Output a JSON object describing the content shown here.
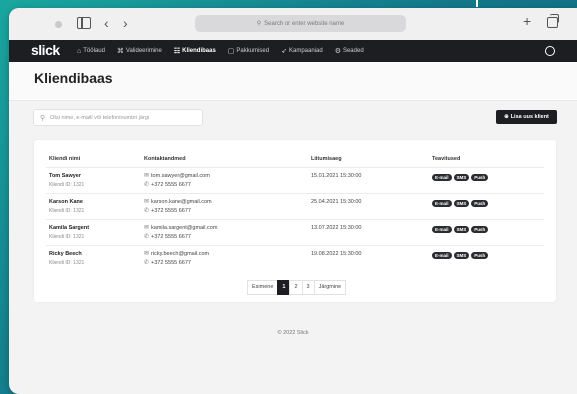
{
  "browser": {
    "address_placeholder": "Search or enter website name"
  },
  "app": {
    "logo": "slick",
    "nav": [
      {
        "icon": "⌂",
        "label": "Töölaud"
      },
      {
        "icon": "⌘",
        "label": "Valideerimine"
      },
      {
        "icon": "☷",
        "label": "Kliendibaas",
        "active": true
      },
      {
        "icon": "▢",
        "label": "Pakkumised"
      },
      {
        "icon": "➶",
        "label": "Kampaaniad"
      },
      {
        "icon": "⚙",
        "label": "Seaded"
      }
    ]
  },
  "page": {
    "title": "Kliendibaas",
    "search_placeholder": "Otsi nime, e-maili või telefoninumbri järgi",
    "add_button": "Lisa uus klient",
    "add_icon": "⊕"
  },
  "table": {
    "headers": [
      "Kliendi nimi",
      "Kontaktandmed",
      "Liitumisaeg",
      "Teavitused"
    ],
    "rows": [
      {
        "name": "Tom Sawyer",
        "id": "Kliendi ID: 1321",
        "email": "tom.sawyer@gmail.com",
        "phone": "+372 5555 6677",
        "joined": "15.01.2021 15:30:00",
        "badges": [
          "E-mail",
          "SMS",
          "Push"
        ]
      },
      {
        "name": "Karson Kane",
        "id": "Kliendi ID: 1321",
        "email": "karson.kane@gmail.com",
        "phone": "+372 5555 6677",
        "joined": "25.04.2021 15:30:00",
        "badges": [
          "E-mail",
          "SMS",
          "Push"
        ]
      },
      {
        "name": "Kamila Sargent",
        "id": "Kliendi ID: 1321",
        "email": "kamila.sargent@gmail.com",
        "phone": "+372 5555 6677",
        "joined": "13.07.2022 15:30:00",
        "badges": [
          "E-mail",
          "SMS",
          "Push"
        ]
      },
      {
        "name": "Ricky Beech",
        "id": "Kliendi ID: 1321",
        "email": "ricky.beech@gmail.com",
        "phone": "+372 5555 6677",
        "joined": "19.08.2022 15:30:00",
        "badges": [
          "E-mail",
          "SMS",
          "Push"
        ]
      }
    ]
  },
  "pagination": {
    "first": "Esimene",
    "pages": [
      "1",
      "2",
      "3"
    ],
    "current": "1",
    "next": "Järgmine"
  },
  "footer": "© 2022 Slick"
}
